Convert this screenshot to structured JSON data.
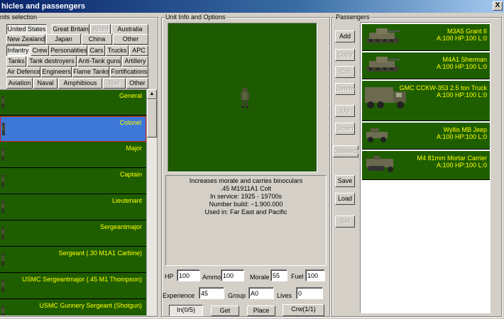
{
  "window": {
    "title": "Vehicles and passengers",
    "title_visible": "hicles and passengers",
    "close_label": "X"
  },
  "units_group": {
    "title": "Units selection",
    "title_visible": "nits selection"
  },
  "nation_filters": [
    {
      "label": "United States",
      "state": "pressed"
    },
    {
      "label": "Great Britain",
      "state": "normal"
    },
    {
      "label": "Allied",
      "state": "disabled"
    },
    {
      "label": "Australia",
      "state": "normal"
    },
    {
      "label": "New Zealand",
      "state": "normal"
    },
    {
      "label": "Japan",
      "state": "normal"
    },
    {
      "label": "China",
      "state": "normal"
    },
    {
      "label": "Other",
      "state": "normal"
    }
  ],
  "type_filters": [
    {
      "label": "Infantry",
      "state": "pressed"
    },
    {
      "label": "Crew",
      "state": "normal"
    },
    {
      "label": "Personalities",
      "state": "normal"
    },
    {
      "label": "Cars",
      "state": "normal"
    },
    {
      "label": "Trucks",
      "state": "normal"
    },
    {
      "label": "APC",
      "state": "normal"
    },
    {
      "label": "Tanks",
      "state": "normal"
    },
    {
      "label": "Tank destroyers",
      "state": "normal"
    },
    {
      "label": "Anti-Tank guns",
      "state": "normal"
    },
    {
      "label": "Artillery",
      "state": "normal"
    },
    {
      "label": "Air Defence",
      "state": "normal"
    },
    {
      "label": "Engineers",
      "state": "normal"
    },
    {
      "label": "Flame Tanks",
      "state": "normal"
    },
    {
      "label": "Fortifications",
      "state": "normal"
    },
    {
      "label": "Aviation",
      "state": "normal"
    },
    {
      "label": "Naval",
      "state": "normal"
    },
    {
      "label": "Amphibious",
      "state": "normal"
    },
    {
      "label": "Rail",
      "state": "disabled"
    },
    {
      "label": "Other",
      "state": "normal"
    }
  ],
  "units": [
    {
      "name": "General",
      "selected": false
    },
    {
      "name": "Colonel",
      "selected": true
    },
    {
      "name": "Major",
      "selected": false
    },
    {
      "name": "Captain",
      "selected": false
    },
    {
      "name": "Lieutenant",
      "selected": false
    },
    {
      "name": "Sergeantmajor",
      "selected": false
    },
    {
      "name": "Sergeant (.30 M1A1 Carbine)",
      "selected": false
    },
    {
      "name": "USMC Sergeantmajor (.45 M1 Thompson)",
      "selected": false
    },
    {
      "name": "USMC Gunnery Sergeant (Shotgun)",
      "selected": false
    }
  ],
  "info_group": {
    "title": "Unit Info and Options"
  },
  "description": [
    "Increases morale and carries binoculars",
    ".45 M1911A1 Colt",
    "In service: 1925 - 19700s",
    "Number build: ~1.900.000",
    "Used in: Far East and Pacific"
  ],
  "fields": {
    "hp": {
      "label": "HP",
      "value": "100"
    },
    "ammo": {
      "label": "Ammo",
      "value": "100"
    },
    "morale": {
      "label": "Morale",
      "value": "55"
    },
    "fuel": {
      "label": "Fuel",
      "value": "100"
    },
    "experience": {
      "label": "Experience",
      "value": "45"
    },
    "group": {
      "label": "Group",
      "value": "A0"
    },
    "lives": {
      "label": "Lives",
      "value": "0"
    }
  },
  "bottom_buttons": {
    "in": "In(0/5)",
    "get": "Get",
    "place": "Place",
    "crew": "Crw(1/1)"
  },
  "passengers_group": {
    "title": "Passengers"
  },
  "side_buttons": [
    {
      "label": "Add",
      "enabled": true
    },
    {
      "label": "Copy",
      "enabled": false
    },
    {
      "label": "Cut",
      "enabled": false
    },
    {
      "label": "Delete",
      "enabled": false
    },
    {
      "label": "Up",
      "enabled": false
    },
    {
      "label": "Down",
      "enabled": false
    },
    {
      "label": "Deselect",
      "enabled": false
    },
    {
      "label": "Save",
      "enabled": true
    },
    {
      "label": "Load",
      "enabled": true
    },
    {
      "label": "Set",
      "enabled": false
    }
  ],
  "passengers": [
    {
      "name": "M3A5 Grant II",
      "stats": "A:100 HP:100 L:0",
      "icon": "tank-icon"
    },
    {
      "name": "M4A1 Sherman",
      "stats": "A:100 HP:100 L:0",
      "icon": "tank-icon"
    },
    {
      "name": "GMC CCKW-353 2.5 ton Truck",
      "stats": "A:100 HP:100 L:0",
      "icon": "truck-icon"
    },
    {
      "name": "Wyllis MB Jeep",
      "stats": "A:100 HP:100 L:0",
      "icon": "jeep-icon"
    },
    {
      "name": "M4 81mm Mortar Carrier",
      "stats": "A:100 HP:100 L:0",
      "icon": "halftrack-icon"
    }
  ],
  "colors": {
    "list_bg": "#1f5e00",
    "text_yellow": "#ffff00",
    "selected_bg": "#3d78d8"
  }
}
